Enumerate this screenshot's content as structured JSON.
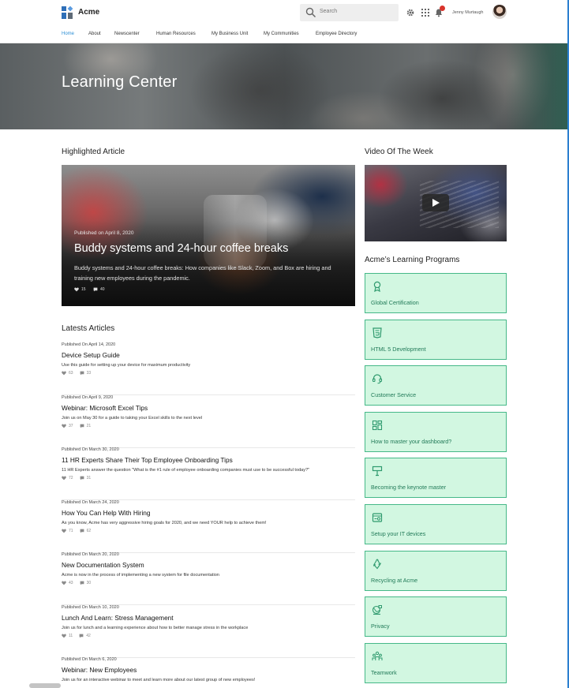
{
  "header": {
    "brand": "Acme",
    "search_placeholder": "Search",
    "user_name": "Jenny Murtaugh"
  },
  "nav": {
    "items": [
      {
        "label": "Home",
        "active": true
      },
      {
        "label": "About"
      },
      {
        "label": "Newscenter"
      },
      {
        "label": "Human Resources"
      },
      {
        "label": "My Business Unit"
      },
      {
        "label": "My Communities"
      },
      {
        "label": "Employee Directory"
      }
    ]
  },
  "hero": {
    "title": "Learning Center"
  },
  "highlighted": {
    "section_title": "Highlighted Article",
    "published": "Published on   April 8, 2020",
    "title": "Buddy systems and 24-hour coffee breaks",
    "description": "Buddy systems and 24-hour coffee breaks: How companies like Slack, Zoom, and Box are hiring and training new employees during the pandemic.",
    "likes": "15",
    "comments": "40"
  },
  "latest": {
    "section_title": "Latests Articles",
    "articles": [
      {
        "published": "Published  On April 14, 2020",
        "title": "Device Setup Guide",
        "description": "Use this guide for setting up your device for maximum productivity",
        "likes": "63",
        "comments": "33"
      },
      {
        "published": "Published  On April 9, 2020",
        "title": "Webinar: Microsoft Excel Tips",
        "description": "Join us on May 30 for a guide to taking your Excel skills to the next level",
        "likes": "37",
        "comments": "21"
      },
      {
        "published": "Published  On March 30, 2020",
        "title": "11 HR Experts Share Their Top Employee Onboarding Tips",
        "description": "11 HR Experts answer the question \"What is the #1 rule of employee onboarding companies must use to be successful today?\"",
        "likes": "72",
        "comments": "31"
      },
      {
        "published": "Published  On March 24, 2020",
        "title": "How You Can Help With Hiring",
        "description": "As you know, Acme has very aggressive hiring goals for 2020, and we need YOUR help to achieve them!",
        "likes": "71",
        "comments": "62"
      },
      {
        "published": "Published  On March 20, 2020",
        "title": "New Documentation System",
        "description": "Acme is now in the process of implementing a new system for file documentation",
        "likes": "43",
        "comments": "30"
      },
      {
        "published": "Published  On March 10, 2020",
        "title": "Lunch And Learn: Stress Management",
        "description": "Join us for lunch and a learning experience about how to better manage stress in the workplace",
        "likes": "11",
        "comments": "42"
      },
      {
        "published": "Published  On March 6, 2020",
        "title": "Webinar: New Employees",
        "description": "Join us for an interactive webinar to meet and learn more about our latest group of new employees!",
        "likes": "",
        "comments": ""
      }
    ]
  },
  "video": {
    "section_title": "Video Of The Week"
  },
  "programs": {
    "section_title": "Acme’s Learning Programs",
    "accent_color": "#2f9a6e",
    "background_color": "#d2f7e1",
    "items": [
      {
        "label": "Global Certification",
        "icon": "award-icon"
      },
      {
        "label": "HTML 5 Development",
        "icon": "html5-icon"
      },
      {
        "label": "Customer Service",
        "icon": "headset-icon"
      },
      {
        "label": "How to master your dashboard?",
        "icon": "dashboard-icon"
      },
      {
        "label": "Becoming the keynote master",
        "icon": "presentation-icon"
      },
      {
        "label": "Setup your IT devices",
        "icon": "device-icon"
      },
      {
        "label": "Recycling at Acme",
        "icon": "recycle-icon"
      },
      {
        "label": "Privacy",
        "icon": "globe-lock-icon"
      },
      {
        "label": "Teamwork",
        "icon": "team-icon"
      }
    ]
  }
}
